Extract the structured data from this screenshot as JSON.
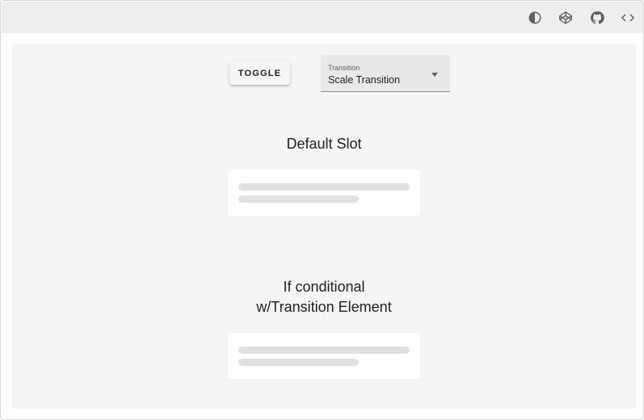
{
  "toolbar": {
    "icons": [
      "contrast-icon",
      "codepen-icon",
      "github-icon",
      "code-icon"
    ]
  },
  "controls": {
    "toggle_label": "TOGGLE",
    "select_label": "Transition",
    "select_value": "Scale Transition"
  },
  "sections": [
    {
      "title": "Default Slot"
    },
    {
      "title_line1": "If conditional",
      "title_line2": "w/Transition Element"
    }
  ],
  "colors": {
    "toolbar_bg": "#eeeeee",
    "stage_bg": "#f5f5f5",
    "skeleton": "#e0e0e0"
  }
}
